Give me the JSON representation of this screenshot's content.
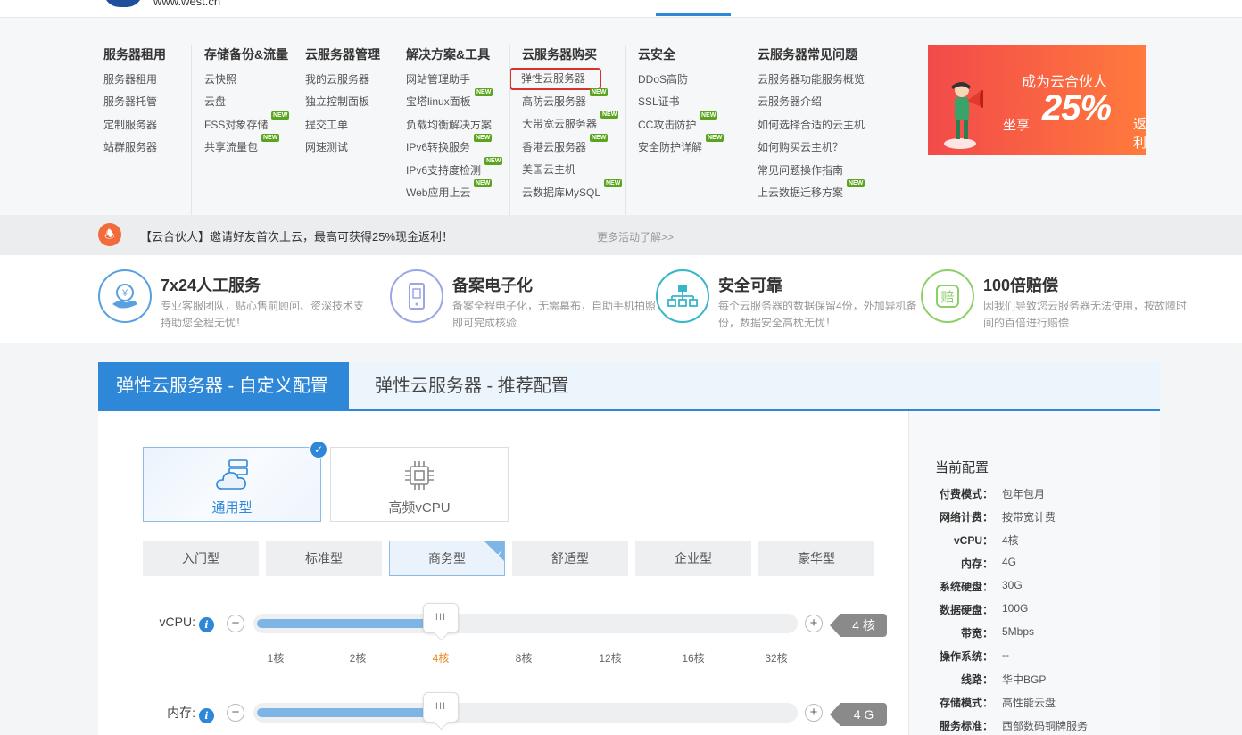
{
  "header": {
    "logo_text": "www.west.cn"
  },
  "menu": {
    "columns": [
      {
        "title": "服务器租用",
        "items": [
          {
            "label": "服务器租用"
          },
          {
            "label": "服务器托管"
          },
          {
            "label": "定制服务器"
          },
          {
            "label": "站群服务器"
          }
        ]
      },
      {
        "title": "存储备份&流量",
        "items": [
          {
            "label": "云快照"
          },
          {
            "label": "云盘"
          },
          {
            "label": "FSS对象存储",
            "badge": "NEW"
          },
          {
            "label": "共享流量包",
            "badge": "NEW"
          }
        ]
      },
      {
        "title": "云服务器管理",
        "items": [
          {
            "label": "我的云服务器"
          },
          {
            "label": "独立控制面板"
          },
          {
            "label": "提交工单"
          },
          {
            "label": "网速测试"
          }
        ]
      },
      {
        "title": "解决方案&工具",
        "items": [
          {
            "label": "网站管理助手"
          },
          {
            "label": "宝塔linux面板",
            "badge": "NEW"
          },
          {
            "label": "负载均衡解决方案"
          },
          {
            "label": "IPv6转换服务",
            "badge": "NEW"
          },
          {
            "label": "IPv6支持度检测",
            "badge": "NEW"
          },
          {
            "label": "Web应用上云",
            "badge": "NEW"
          }
        ]
      },
      {
        "title": "云服务器购买",
        "items": [
          {
            "label": "弹性云服务器"
          },
          {
            "label": "高防云服务器",
            "badge": "NEW"
          },
          {
            "label": "大带宽云服务器",
            "badge": "NEW"
          },
          {
            "label": "香港云服务器",
            "badge": "NEW"
          },
          {
            "label": "美国云主机"
          },
          {
            "label": "云数据库MySQL",
            "badge": "NEW"
          }
        ]
      },
      {
        "title": "云安全",
        "items": [
          {
            "label": "DDoS高防"
          },
          {
            "label": "SSL证书"
          },
          {
            "label": "CC攻击防护",
            "badge": "NEW"
          },
          {
            "label": "安全防护详解",
            "badge": "NEW"
          }
        ]
      },
      {
        "title": "云服务器常见问题",
        "items": [
          {
            "label": "云服务器功能服务概览"
          },
          {
            "label": "云服务器介绍"
          },
          {
            "label": "如何选择合适的云主机"
          },
          {
            "label": "如何购买云主机？"
          },
          {
            "label": "常见问题操作指南"
          },
          {
            "label": "上云数据迁移方案",
            "badge": "NEW"
          }
        ]
      }
    ],
    "banner": {
      "line1": "成为云合伙人",
      "line2a": "坐享",
      "line2b": "25%",
      "line2c": "返利"
    }
  },
  "notice": {
    "text": "【云合伙人】邀请好友首次上云，最高可获得25%现金返利！",
    "more": "更多活动了解>>"
  },
  "features": [
    {
      "title": "7x24人工服务",
      "desc": "专业客服团队，贴心售前顾问、资深技术支持助您全程无忧！",
      "icon": "support-icon",
      "color": "#5aa0e0",
      "glyph": "¥"
    },
    {
      "title": "备案电子化",
      "desc": "备案全程电子化，无需幕布，自助手机拍照即可完成核验",
      "icon": "mobile-icon",
      "color": "#9aa6e6",
      "glyph": "▯"
    },
    {
      "title": "安全可靠",
      "desc": "每个云服务器的数据保留4份，外加异机备份，数据安全高枕无忧！",
      "icon": "network-icon",
      "color": "#38b6c9",
      "glyph": "品"
    },
    {
      "title": "100倍赔偿",
      "desc": "因我们导致您云服务器无法使用，按故障时间的百倍进行赔偿",
      "icon": "compensation-icon",
      "color": "#8fcf6a",
      "glyph": "赔"
    }
  ],
  "tabs": [
    "弹性云服务器 - 自定义配置",
    "弹性云服务器 - 推荐配置"
  ],
  "type_cards": [
    {
      "label": "通用型",
      "selected": true
    },
    {
      "label": "高频vCPU",
      "selected": false
    }
  ],
  "tiers": [
    {
      "label": "入门型"
    },
    {
      "label": "标准型"
    },
    {
      "label": "商务型",
      "selected": true
    },
    {
      "label": "舒适型"
    },
    {
      "label": "企业型"
    },
    {
      "label": "豪华型"
    }
  ],
  "sliders": [
    {
      "label": "vCPU:",
      "value": "4 核",
      "ticks": [
        "1核",
        "2核",
        "4核",
        "8核",
        "12核",
        "16核",
        "32核"
      ],
      "current_tick": 2,
      "fill_fraction": 0.33
    },
    {
      "label": "内存:",
      "value": "4 G",
      "ticks": [],
      "current_tick": -1,
      "fill_fraction": 0.33
    }
  ],
  "summary": {
    "title": "当前配置",
    "rows": [
      {
        "k": "付费模式：",
        "v": "包年包月"
      },
      {
        "k": "网络计费：",
        "v": "按带宽计费"
      },
      {
        "k": "vCPU：",
        "v": "4核"
      },
      {
        "k": "内存：",
        "v": "4G"
      },
      {
        "k": "系统硬盘：",
        "v": "30G"
      },
      {
        "k": "数据硬盘：",
        "v": "100G"
      },
      {
        "k": "带宽：",
        "v": "5Mbps"
      },
      {
        "k": "操作系统：",
        "v": "--"
      },
      {
        "k": "线路：",
        "v": "华中BGP"
      },
      {
        "k": "存储模式：",
        "v": "高性能云盘"
      },
      {
        "k": "服务标准：",
        "v": "西部数码铜牌服务"
      }
    ]
  }
}
